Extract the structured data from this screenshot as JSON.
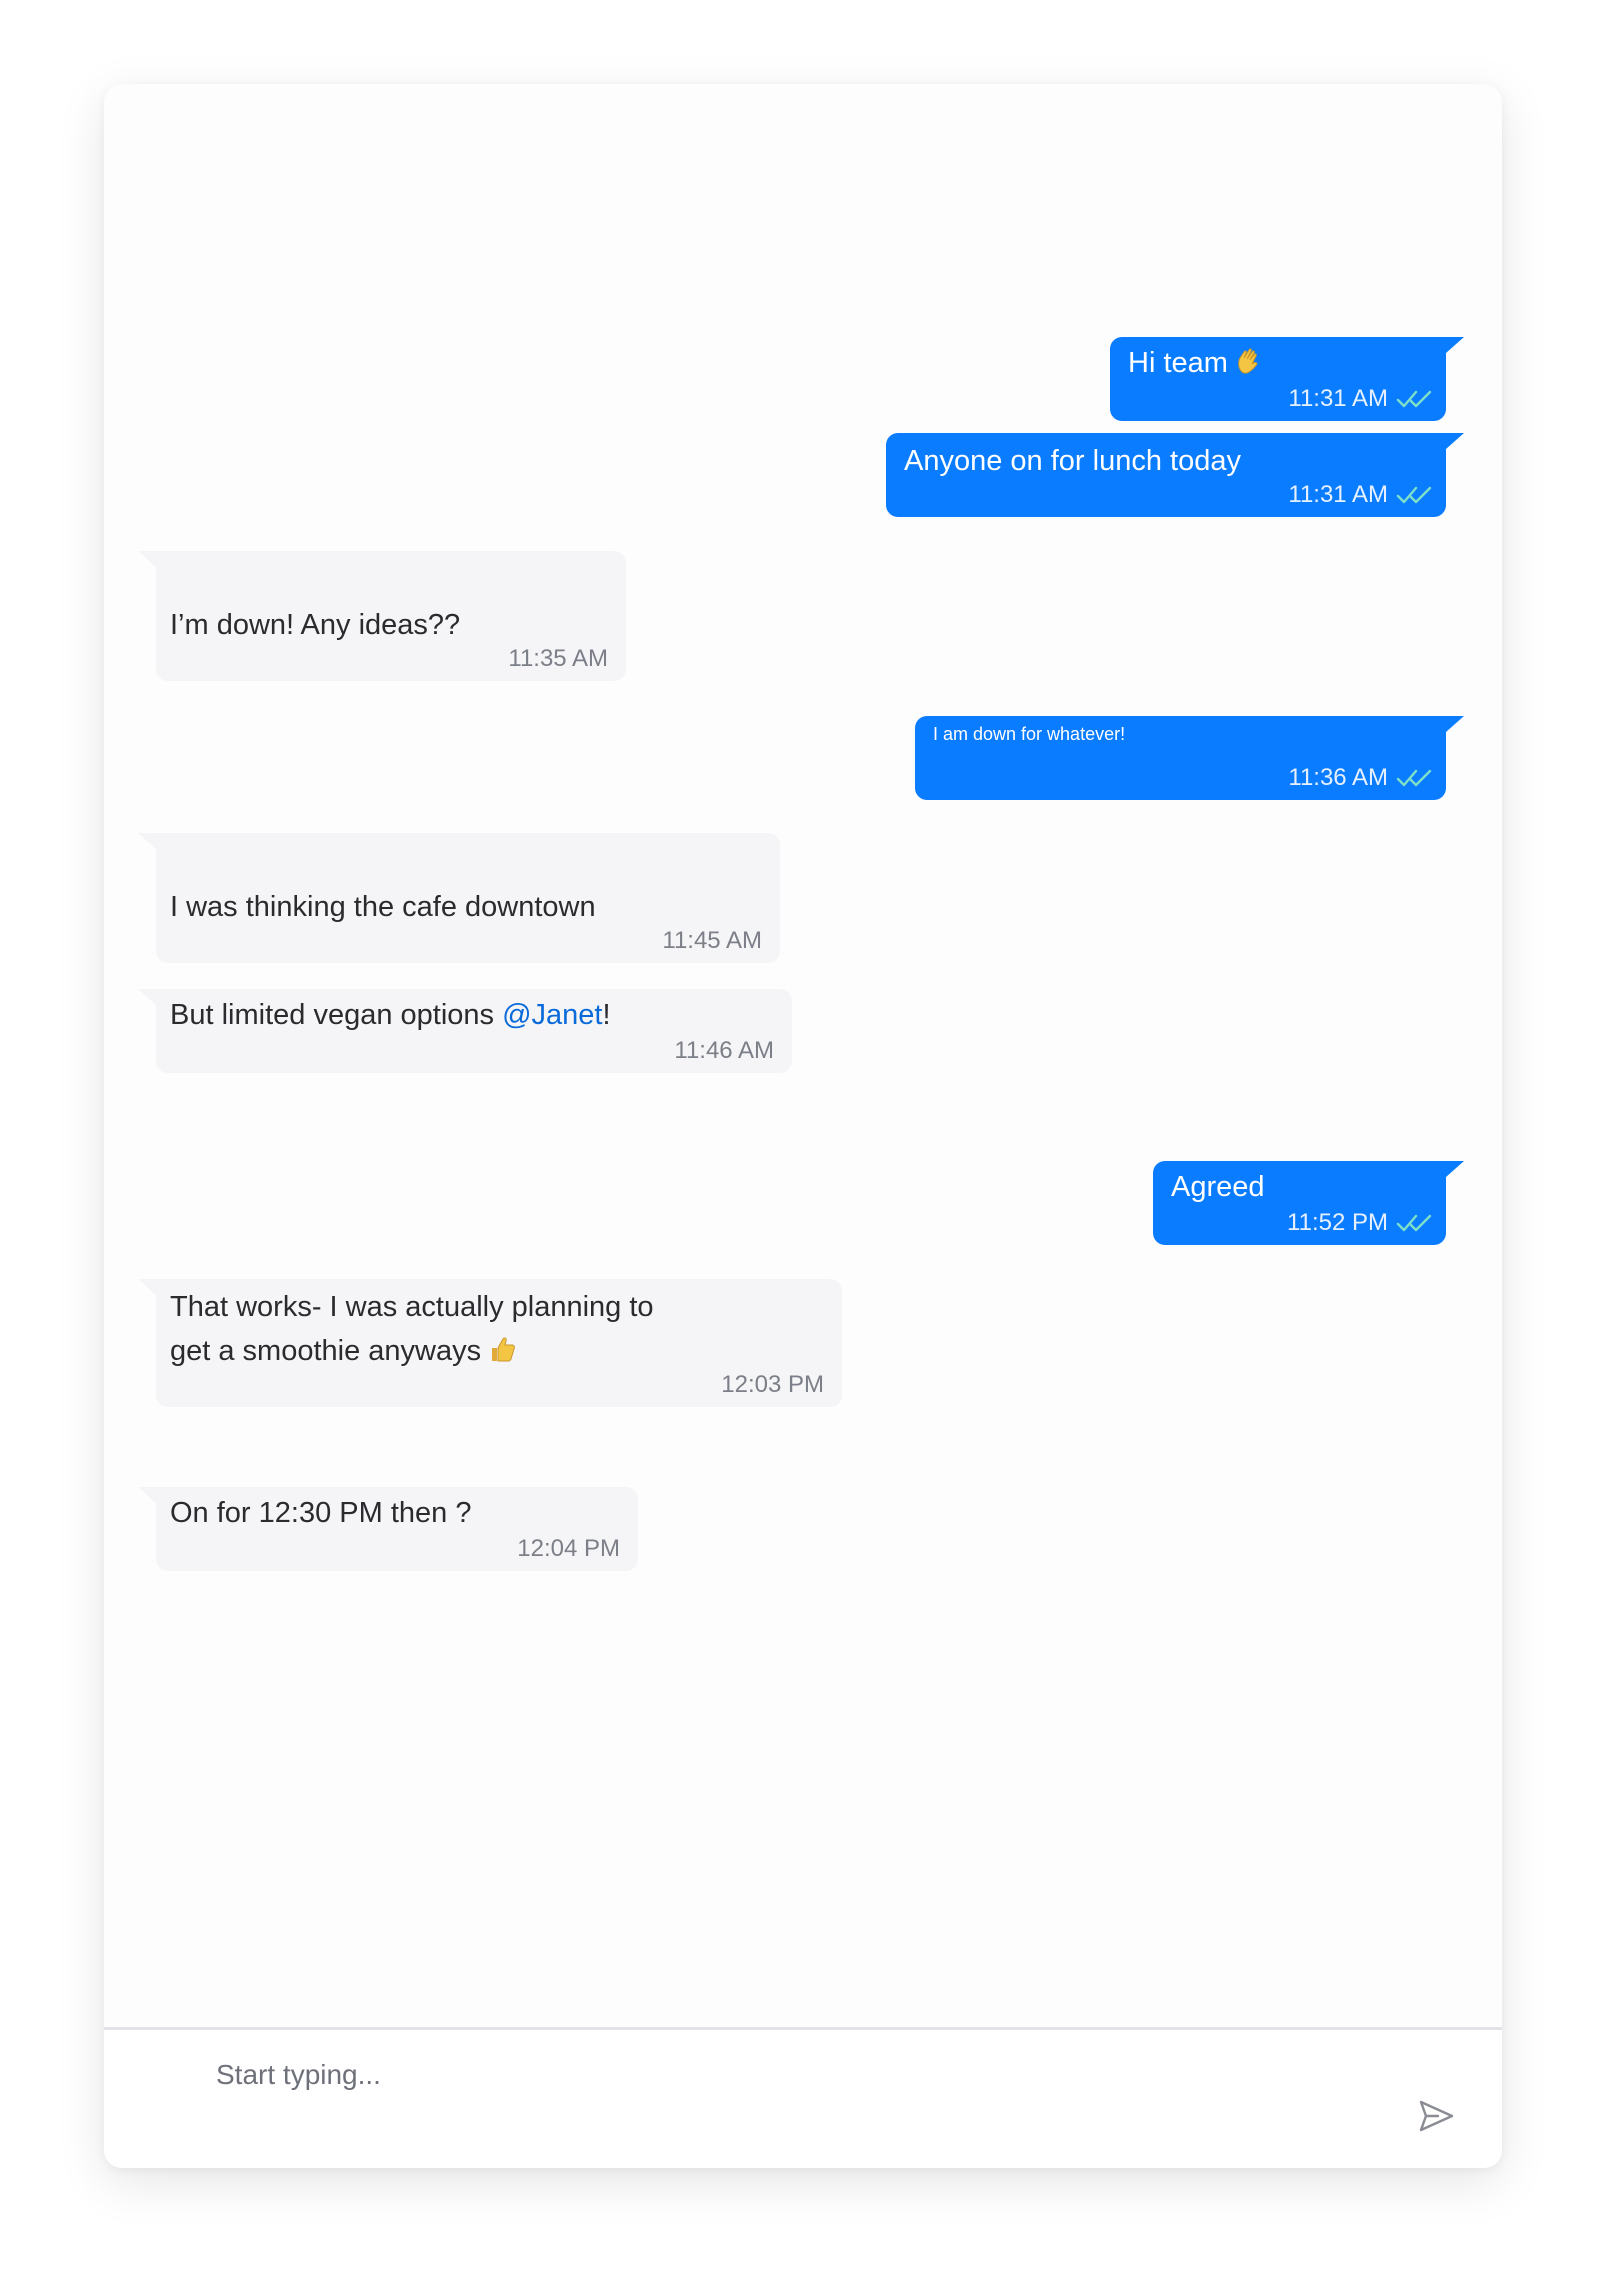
{
  "messages": [
    {
      "direction": "out",
      "text": "Hi team",
      "time": "11:31 AM",
      "emoji": "waving-hand-icon"
    },
    {
      "direction": "out",
      "text": "Anyone on for lunch today",
      "time": "11:31 AM"
    },
    {
      "direction": "in",
      "text": "I’m down! Any ideas??",
      "time": "11:35 AM"
    },
    {
      "direction": "out",
      "text": "I am down for whatever!",
      "time": "11:36 AM"
    },
    {
      "direction": "in",
      "text": "I was thinking the cafe downtown",
      "time": "11:45 AM"
    },
    {
      "direction": "in",
      "text_before": "But limited vegan options ",
      "mention": "@Janet",
      "text_after": "!",
      "time": "11:46 AM"
    },
    {
      "direction": "out",
      "text": "Agreed",
      "time": "11:52 PM"
    },
    {
      "direction": "in",
      "line1": "That works- I was actually planning to",
      "line2": "get a smoothie anyways",
      "time": "12:03 PM",
      "emoji": "thumbs-up-icon"
    },
    {
      "direction": "in",
      "text": "On for 12:30 PM then ?",
      "time": "12:04 PM"
    }
  ],
  "composer": {
    "placeholder": "Start typing..."
  },
  "colors": {
    "outgoing_bubble": "#0a7cff",
    "incoming_bubble": "#f5f5f7",
    "mention": "#0a6ad9",
    "read_check": "#7ee0c8"
  }
}
